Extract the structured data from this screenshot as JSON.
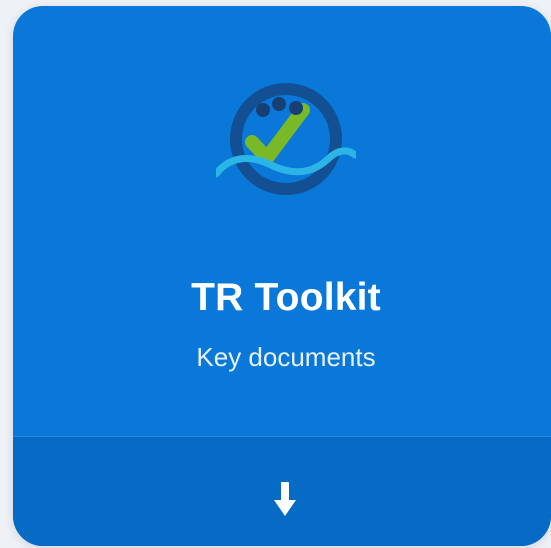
{
  "card": {
    "title": "TR Toolkit",
    "subtitle": "Key documents"
  },
  "icons": {
    "logo": "checkmark-wave-logo",
    "footer": "download-arrow-icon"
  },
  "colors": {
    "card_background": "#0a78d8",
    "footer_background": "#066bc4",
    "logo_ring": "#124f93",
    "logo_check": "#79b928",
    "logo_wave": "#2bb4e6",
    "logo_dots": "#173f73"
  }
}
